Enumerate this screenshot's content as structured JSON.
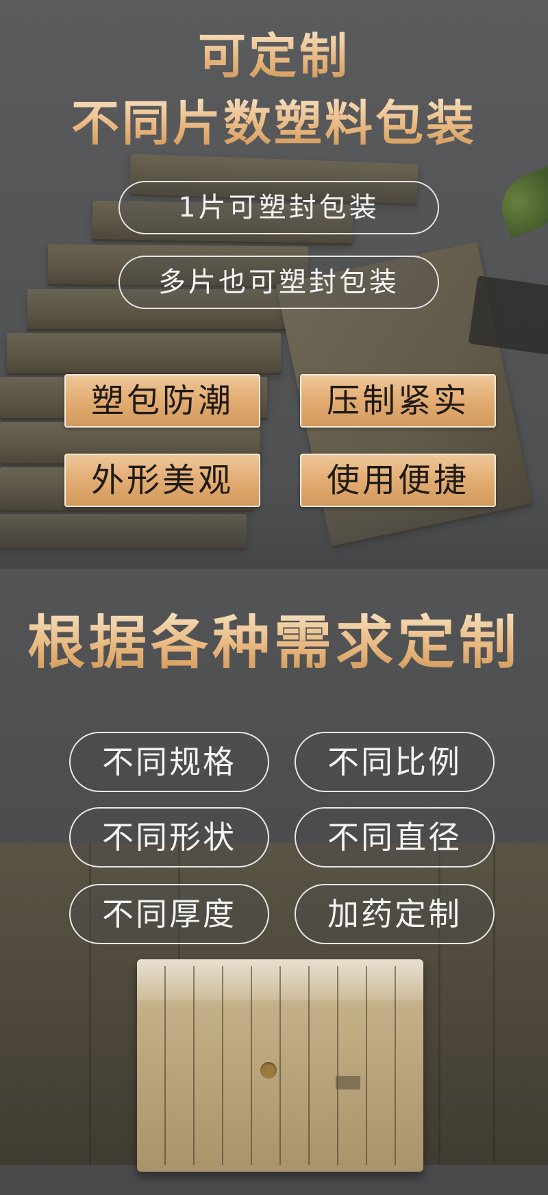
{
  "section1": {
    "title_line1": "可定制",
    "title_line2": "不同片数塑料包装",
    "pills": [
      "1片可塑封包装",
      "多片也可塑封包装"
    ],
    "features": [
      "塑包防潮",
      "压制紧实",
      "外形美观",
      "使用便捷"
    ]
  },
  "section2": {
    "title": "根据各种需求定制",
    "specs": [
      "不同规格",
      "不同比例",
      "不同形状",
      "不同直径",
      "不同厚度",
      "加药定制"
    ]
  },
  "colors": {
    "gold_light": "#f7e2c2",
    "gold_dark": "#cf9656",
    "background": "#4f5052"
  }
}
